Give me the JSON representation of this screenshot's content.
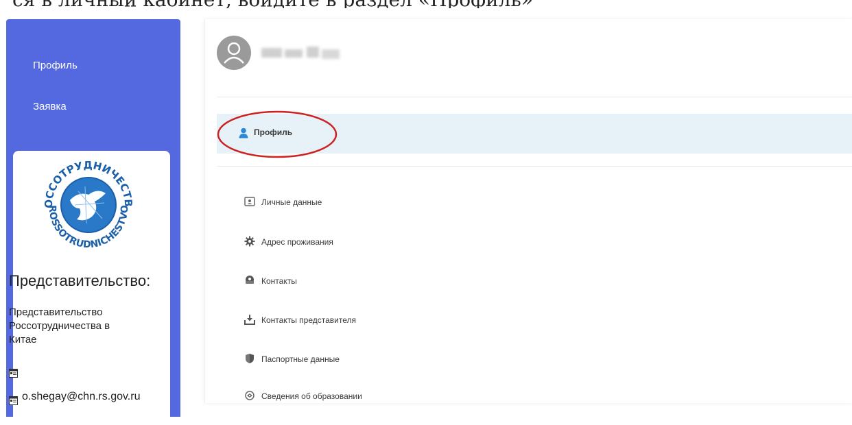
{
  "top_caption": "ся в личный кабинет, войдите в раздел «Профиль»",
  "sidebar": {
    "items": [
      {
        "label": "Профиль"
      },
      {
        "label": "Заявка"
      }
    ],
    "rep_card": {
      "logo_text_top": "РОССОТРУДНИЧЕСТВО",
      "logo_text_bottom": "ROSSOTRUDNICHESTVO",
      "title": "Представительство:",
      "name": "Представительство Россотрудничества в Китае",
      "email": "o.shegay@chn.rs.gov.ru"
    }
  },
  "main": {
    "profile_tab": {
      "label": "Профиль"
    },
    "menu": [
      {
        "label": "Личные данные",
        "icon": "id-card-icon"
      },
      {
        "label": "Адрес проживания",
        "icon": "gear-icon"
      },
      {
        "label": "Контакты",
        "icon": "contacts-icon"
      },
      {
        "label": "Контакты представителя",
        "icon": "download-icon"
      },
      {
        "label": "Паспортные данные",
        "icon": "shield-icon"
      },
      {
        "label": "Сведения об образовании",
        "icon": "education-icon"
      }
    ]
  },
  "colors": {
    "sidebar": "#5468e0",
    "tab_highlight": "#e6f2f8",
    "annotation": "#cc2222",
    "logo_blue": "#2a78c8"
  }
}
